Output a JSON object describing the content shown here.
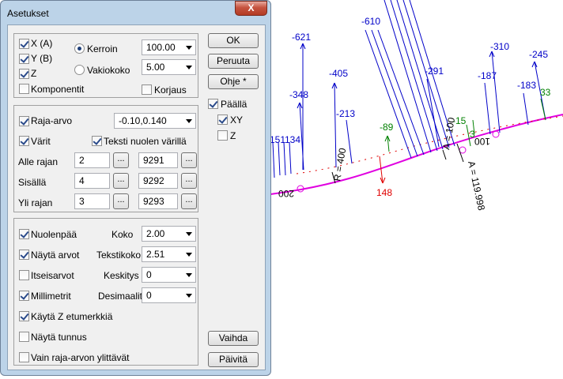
{
  "window": {
    "title": "Asetukset",
    "close_glyph": "X"
  },
  "buttons": {
    "ok": "OK",
    "cancel": "Peruuta",
    "help": "Ohje *",
    "change": "Vaihda",
    "update": "Päivitä",
    "browse": "..."
  },
  "group1": {
    "x_label": "X (A)",
    "x_checked": true,
    "y_label": "Y (B)",
    "y_checked": true,
    "z_label": "Z",
    "z_checked": true,
    "components_label": "Komponentit",
    "components_checked": false,
    "factor_label": "Kerroin",
    "factor_selected": true,
    "factor_value": "100.00",
    "constant_label": "Vakiokoko",
    "constant_selected": false,
    "constant_value": "5.00",
    "fix_label": "Korjaus",
    "fix_checked": false
  },
  "on_panel": {
    "on_label": "Päällä",
    "on_checked": true,
    "xy_label": "XY",
    "xy_checked": true,
    "z_label": "Z",
    "z_checked": false
  },
  "group2": {
    "limit_label": "Raja-arvo",
    "limit_checked": true,
    "limit_value": "-0.10,0.140",
    "colors_label": "Värit",
    "colors_checked": true,
    "textcolor_label": "Teksti nuolen värillä",
    "textcolor_checked": true,
    "rows": [
      {
        "label": "Alle rajan",
        "count": "2",
        "code": "9291"
      },
      {
        "label": "Sisällä",
        "count": "4",
        "code": "9292"
      },
      {
        "label": "Yli rajan",
        "count": "3",
        "code": "9293"
      }
    ]
  },
  "group3": {
    "arrowhead_label": "Nuolenpää",
    "arrowhead_checked": true,
    "showvalues_label": "Näytä arvot",
    "showvalues_checked": true,
    "absolute_label": "Itseisarvot",
    "absolute_checked": false,
    "mm_label": "Millimetrit",
    "mm_checked": true,
    "zprefix_label": "Käytä Z etumerkkiä",
    "zprefix_checked": true,
    "showid_label": "Näytä tunnus",
    "showid_checked": false,
    "onlyexceed_label": "Vain raja-arvon ylittävät",
    "onlyexceed_checked": false,
    "size_label": "Koko",
    "size_value": "2.00",
    "textsize_label": "Tekstikoko",
    "textsize_value": "2.51",
    "center_label": "Keskitys",
    "center_value": "0",
    "decimals_label": "Desimaalit",
    "decimals_value": "0"
  },
  "drawing": {
    "blue_labels": [
      "-621",
      "-610",
      "-291",
      "-310",
      "-245",
      "-405",
      "-187",
      "-183",
      "-348",
      "-213",
      "151",
      "134"
    ],
    "green_labels": [
      "-89",
      "-15",
      "3",
      "33"
    ],
    "red_label": "148",
    "chainage_labels": [
      "200",
      "100"
    ],
    "curve_labels": [
      "R = 400",
      "A = 100",
      "A = 119.998"
    ],
    "colors": {
      "curve": "#e000e0",
      "blue": "#0000c8",
      "green": "#008000",
      "red": "#e00000",
      "cyan": "#00c8ff"
    }
  }
}
